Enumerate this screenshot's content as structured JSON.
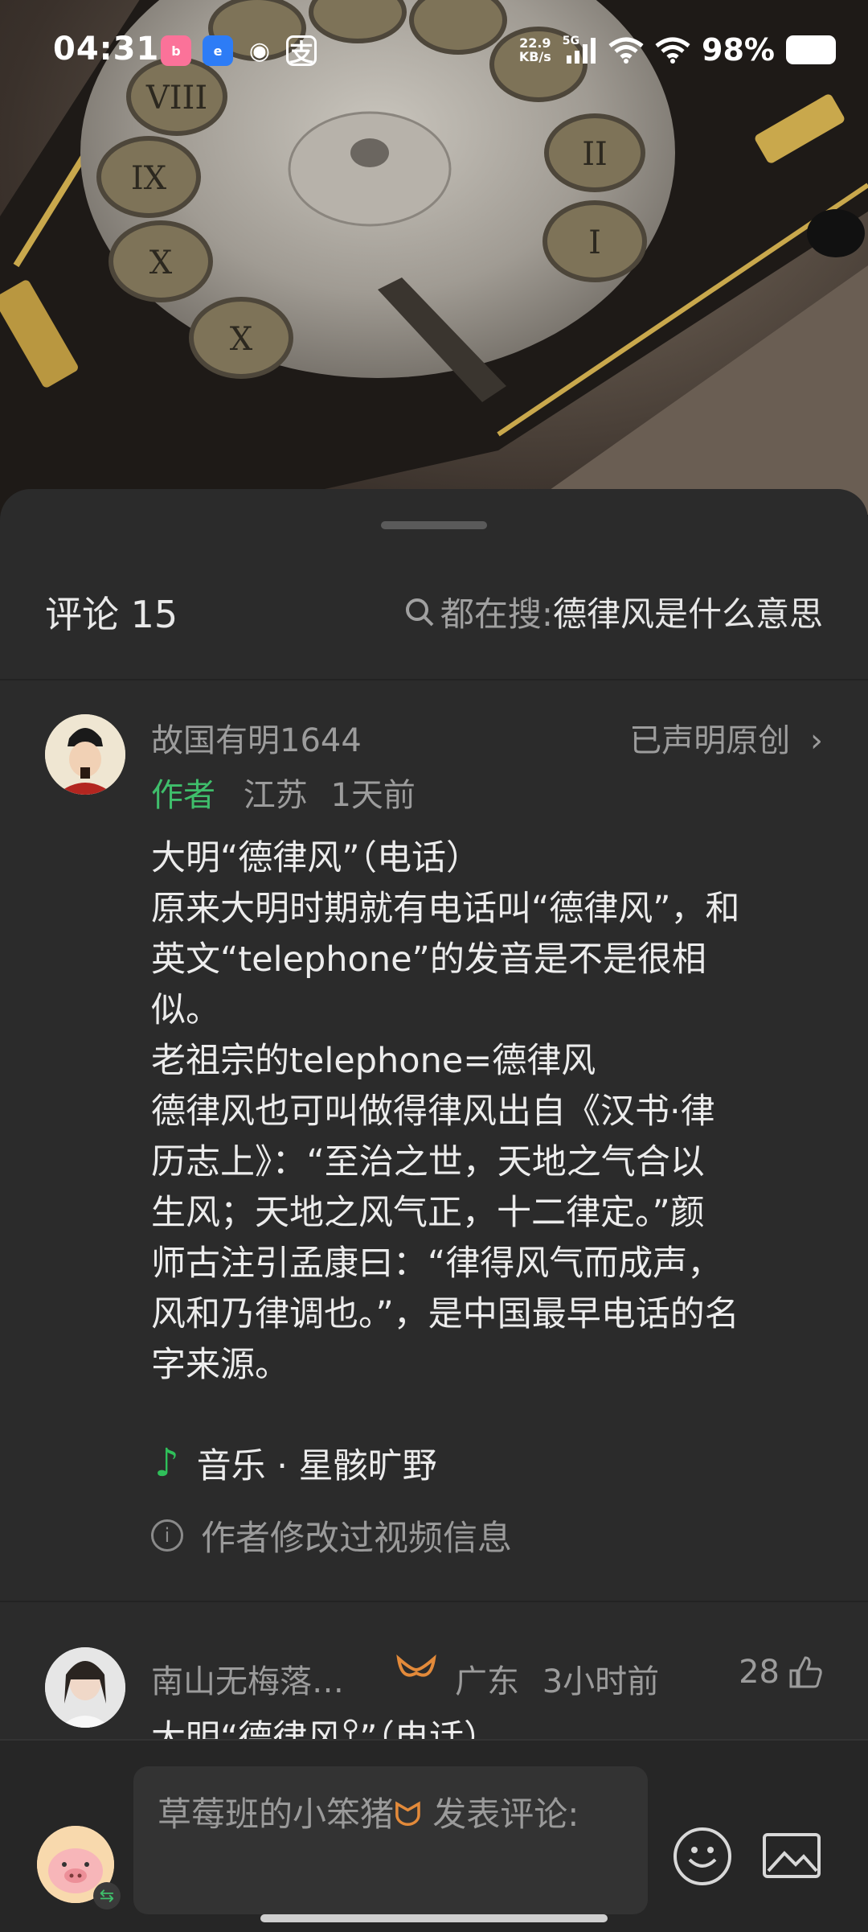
{
  "status_bar": {
    "time": "04:31",
    "net_speed_top": "22.9",
    "net_speed_unit": "KB/s",
    "net_type": "5G",
    "battery": "98%"
  },
  "sheet": {
    "title": "评论 15",
    "trending_prefix": "都在搜: ",
    "trending_term": "德律风是什么意思"
  },
  "comment": {
    "username": "故国有明1644",
    "original_label": "已声明原创",
    "author_tag": "作者",
    "location": "江苏",
    "time": "1天前",
    "text": "大明“德律风”（电话）\n原来大明时期就有电话叫“德律风”，和\n英文“telephone”的发音是不是很相\n似。\n老祖宗的telephone=德律风\n德律风也可叫做得律风出自《汉书·律\n历志上》：“至治之世，天地之气合以\n生风；天地之风气正，十二律定。”颜\n师古注引孟康曰：“律得风气而成声，\n风和乃律调也。”，是中国最早电话的名\n字来源。",
    "music": "音乐 · 星骸旷野",
    "edit_notice": "作者修改过视频信息"
  },
  "comment2": {
    "username": "南山无梅落…",
    "location": "广东",
    "time": "3小时前",
    "likes": "28",
    "text": "大明“德律风",
    "text_tail": "”（电话）"
  },
  "input": {
    "nickname": "草莓班的小笨猪",
    "prompt": " 发表评论:"
  }
}
